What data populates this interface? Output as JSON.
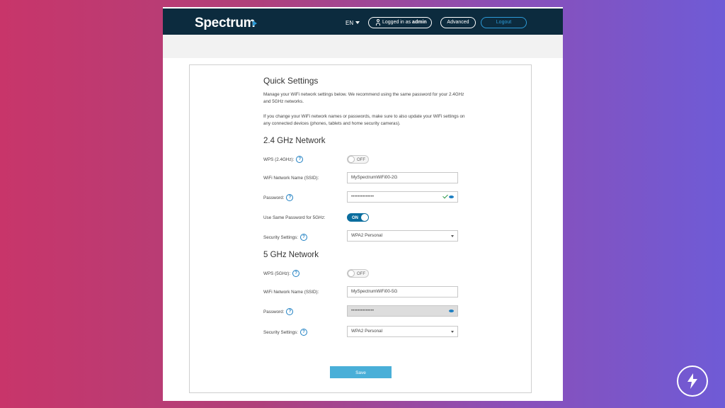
{
  "navbar": {
    "logo": "Spectrum",
    "language": "EN",
    "login_prefix": "Logged in as",
    "login_user": "admin",
    "advanced_label": "Advanced",
    "logout_label": "Logout"
  },
  "quick_settings": {
    "title": "Quick Settings",
    "intro": "Manage your WiFi network settings below. We recommend using the same password for your 2.4GHz and 5GHz networks.",
    "note": "If you change your WiFi network names or passwords, make sure to also update your WiFi settings on any connected devices (phones, tablets and home security cameras)."
  },
  "network_24": {
    "title": "2.4 GHz Network",
    "wps_label": "WPS (2.4GHz):",
    "wps_state": "OFF",
    "ssid_label": "WiFi Network Name (SSID):",
    "ssid_value": "MySpectrumWiFi00-2G",
    "password_label": "Password:",
    "password_mask": "••••••••••••••",
    "same_password_label": "Use Same Password for 5GHz:",
    "same_password_state": "ON",
    "security_label": "Security Settings:",
    "security_value": "WPA2 Personal"
  },
  "network_5": {
    "title": "5 GHz Network",
    "wps_label": "WPS (5GHz):",
    "wps_state": "OFF",
    "ssid_label": "WiFi Network Name (SSID):",
    "ssid_value": "MySpectrumWiFi00-5G",
    "password_label": "Password:",
    "password_mask": "••••••••••••••",
    "security_label": "Security Settings:",
    "security_value": "WPA2 Personal"
  },
  "save_label": "Save",
  "help_glyph": "?",
  "colors": {
    "navbar": "#0c2b3e",
    "accent_blue": "#1e7fc2",
    "toggle_on": "#0a6d9e",
    "save_button": "#49afd8"
  }
}
